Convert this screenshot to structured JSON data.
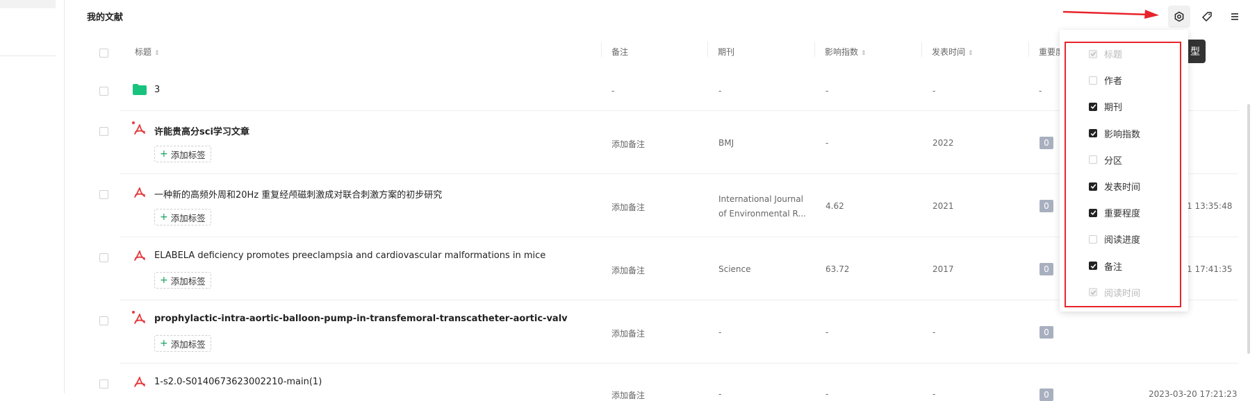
{
  "page_title": "我的文献",
  "toolbar": {
    "settings_icon": "settings-icon",
    "tag_icon": "tag-icon",
    "menu_icon": "menu-icon"
  },
  "headers": {
    "title": "标题",
    "note": "备注",
    "journal": "期刊",
    "impact": "影响指数",
    "published": "发表时间",
    "importance": "重要度"
  },
  "tooltip": "型",
  "rows": [
    {
      "type": "folder",
      "title": "3",
      "note": "-",
      "journal": "-",
      "impact": "-",
      "year": "-",
      "importance": "-"
    },
    {
      "type": "pdf",
      "title": "许能贵高分sci学习文章",
      "bold": true,
      "unread": true,
      "tag": "添加标签",
      "note": "添加备注",
      "journal": "BMJ",
      "impact": "-",
      "year": "2022",
      "importance": "0",
      "read_time": ""
    },
    {
      "type": "pdf",
      "title": "一种新的高频外周和20Hz 重复经颅磁刺激成对联合刺激方案的初步研究",
      "bold": false,
      "unread": false,
      "tag": "添加标签",
      "note": "添加备注",
      "journal_line1": "International Journal",
      "journal_line2": "of Environmental R...",
      "impact": "4.62",
      "year": "2021",
      "importance": "0",
      "read_time": "1 13:35:48"
    },
    {
      "type": "pdf",
      "title": "ELABELA deficiency promotes preeclampsia and cardiovascular malformations in mice",
      "bold": false,
      "unread": false,
      "tag": "添加标签",
      "note": "添加备注",
      "journal": "Science",
      "impact": "63.72",
      "year": "2017",
      "importance": "0",
      "read_time": "1 17:41:35"
    },
    {
      "type": "pdf",
      "title": "prophylactic-intra-aortic-balloon-pump-in-transfemoral-transcatheter-aortic-valv",
      "bold": true,
      "unread": true,
      "tag": "添加标签",
      "note": "添加备注",
      "journal": "-",
      "impact": "-",
      "year": "-",
      "importance": "0",
      "read_time": ""
    },
    {
      "type": "pdf",
      "title": "1-s2.0-S0140673623002210-main(1)",
      "bold": false,
      "unread": false,
      "note": "添加备注",
      "journal": "-",
      "impact": "-",
      "year": "-",
      "importance": "0",
      "read_time": "2023-03-20 17:21:23"
    }
  ],
  "column_menu": [
    {
      "label": "标题",
      "checked": true,
      "disabled": true
    },
    {
      "label": "作者",
      "checked": false,
      "disabled": false
    },
    {
      "label": "期刊",
      "checked": true,
      "disabled": false
    },
    {
      "label": "影响指数",
      "checked": true,
      "disabled": false
    },
    {
      "label": "分区",
      "checked": false,
      "disabled": false
    },
    {
      "label": "发表时间",
      "checked": true,
      "disabled": false
    },
    {
      "label": "重要程度",
      "checked": true,
      "disabled": false
    },
    {
      "label": "阅读进度",
      "checked": false,
      "disabled": false
    },
    {
      "label": "备注",
      "checked": true,
      "disabled": false
    },
    {
      "label": "阅读时间",
      "checked": true,
      "disabled": true
    }
  ],
  "colors": {
    "accent_red": "#e8232b",
    "folder_green": "#19c37d",
    "pdf_red": "#e4393c",
    "badge": "#a8b0bf"
  }
}
